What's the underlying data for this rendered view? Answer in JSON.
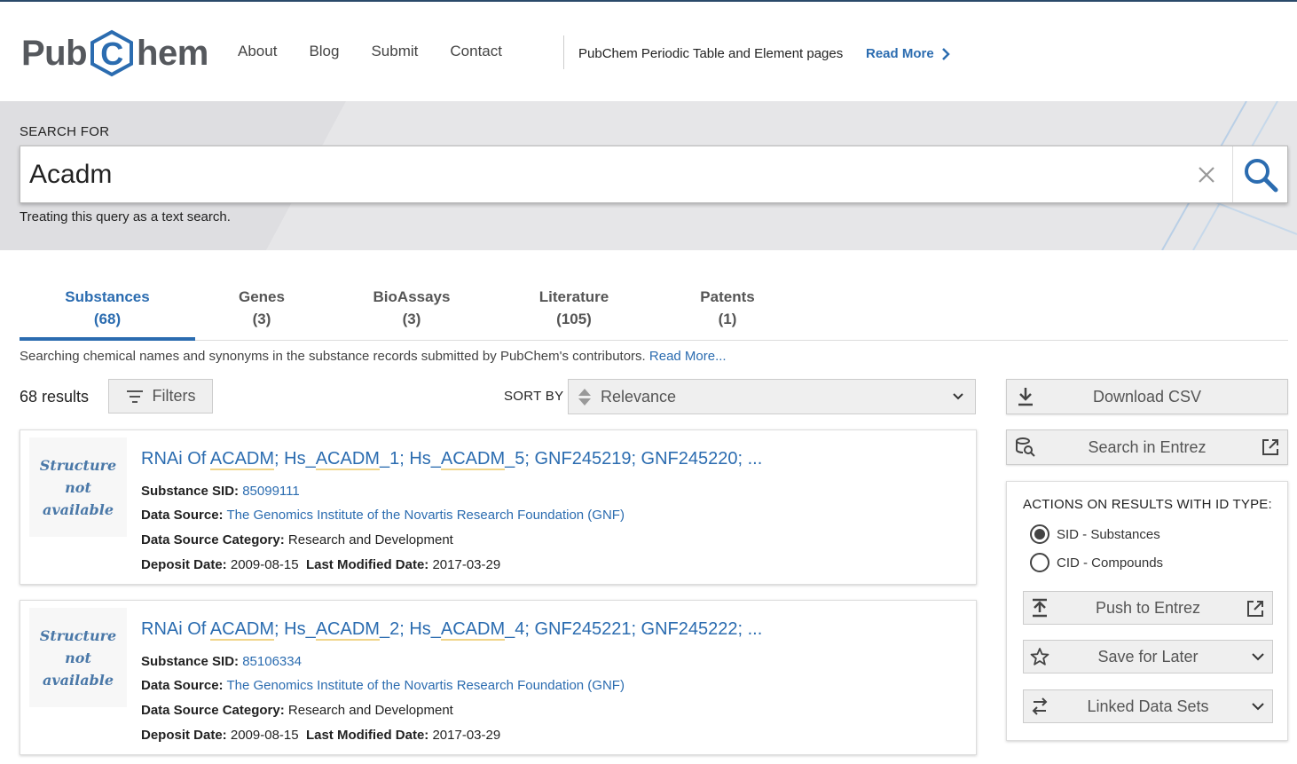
{
  "header": {
    "logo_left": "Pub",
    "logo_mid": "C",
    "logo_right": "hem",
    "nav": [
      "About",
      "Blog",
      "Submit",
      "Contact"
    ],
    "promo_text": "PubChem Periodic Table and Element pages",
    "promo_link": "Read More"
  },
  "search": {
    "label": "SEARCH FOR",
    "value": "Acadm",
    "hint": "Treating this query as a text search."
  },
  "tabs": [
    {
      "label": "Substances",
      "count": "(68)",
      "active": true
    },
    {
      "label": "Genes",
      "count": "(3)"
    },
    {
      "label": "BioAssays",
      "count": "(3)"
    },
    {
      "label": "Literature",
      "count": "(105)"
    },
    {
      "label": "Patents",
      "count": "(1)"
    }
  ],
  "description": {
    "text": "Searching chemical names and synonyms in the substance records submitted by PubChem's contributors.",
    "link": "Read More..."
  },
  "controls": {
    "results_count": "68 results",
    "filters_label": "Filters",
    "sort_label": "SORT BY",
    "sort_value": "Relevance"
  },
  "results": [
    {
      "thumb_line1": "Structure",
      "thumb_line2": "not available",
      "title_parts": [
        "RNAi Of ",
        "ACADM",
        "; Hs_",
        "ACADM",
        "_1; Hs_",
        "ACADM",
        "_5; GNF245219; GNF245220; ..."
      ],
      "sid_label": "Substance SID:",
      "sid": "85099111",
      "source_label": "Data Source:",
      "source": "The Genomics Institute of the Novartis Research Foundation (GNF)",
      "category_label": "Data Source Category:",
      "category": "Research and Development",
      "deposit_label": "Deposit Date:",
      "deposit": "2009-08-15",
      "modified_label": "Last Modified Date:",
      "modified": "2017-03-29"
    },
    {
      "thumb_line1": "Structure",
      "thumb_line2": "not available",
      "title_parts": [
        "RNAi Of ",
        "ACADM",
        "; Hs_",
        "ACADM",
        "_2; Hs_",
        "ACADM",
        "_4; GNF245221; GNF245222; ..."
      ],
      "sid_label": "Substance SID:",
      "sid": "85106334",
      "source_label": "Data Source:",
      "source": "The Genomics Institute of the Novartis Research Foundation (GNF)",
      "category_label": "Data Source Category:",
      "category": "Research and Development",
      "deposit_label": "Deposit Date:",
      "deposit": "2009-08-15",
      "modified_label": "Last Modified Date:",
      "modified": "2017-03-29"
    }
  ],
  "sidebar": {
    "download_csv": "Download CSV",
    "search_entrez": "Search in Entrez",
    "actions_head": "ACTIONS ON RESULTS WITH ID TYPE:",
    "radio_sid": "SID - Substances",
    "radio_cid": "CID - Compounds",
    "push_entrez": "Push to Entrez",
    "save_later": "Save for Later",
    "linked_sets": "Linked Data Sets"
  },
  "colors": {
    "accent": "#2b6cb0",
    "highlight_underline": "#f0d58a",
    "band_bg": "#e6e6e8"
  }
}
